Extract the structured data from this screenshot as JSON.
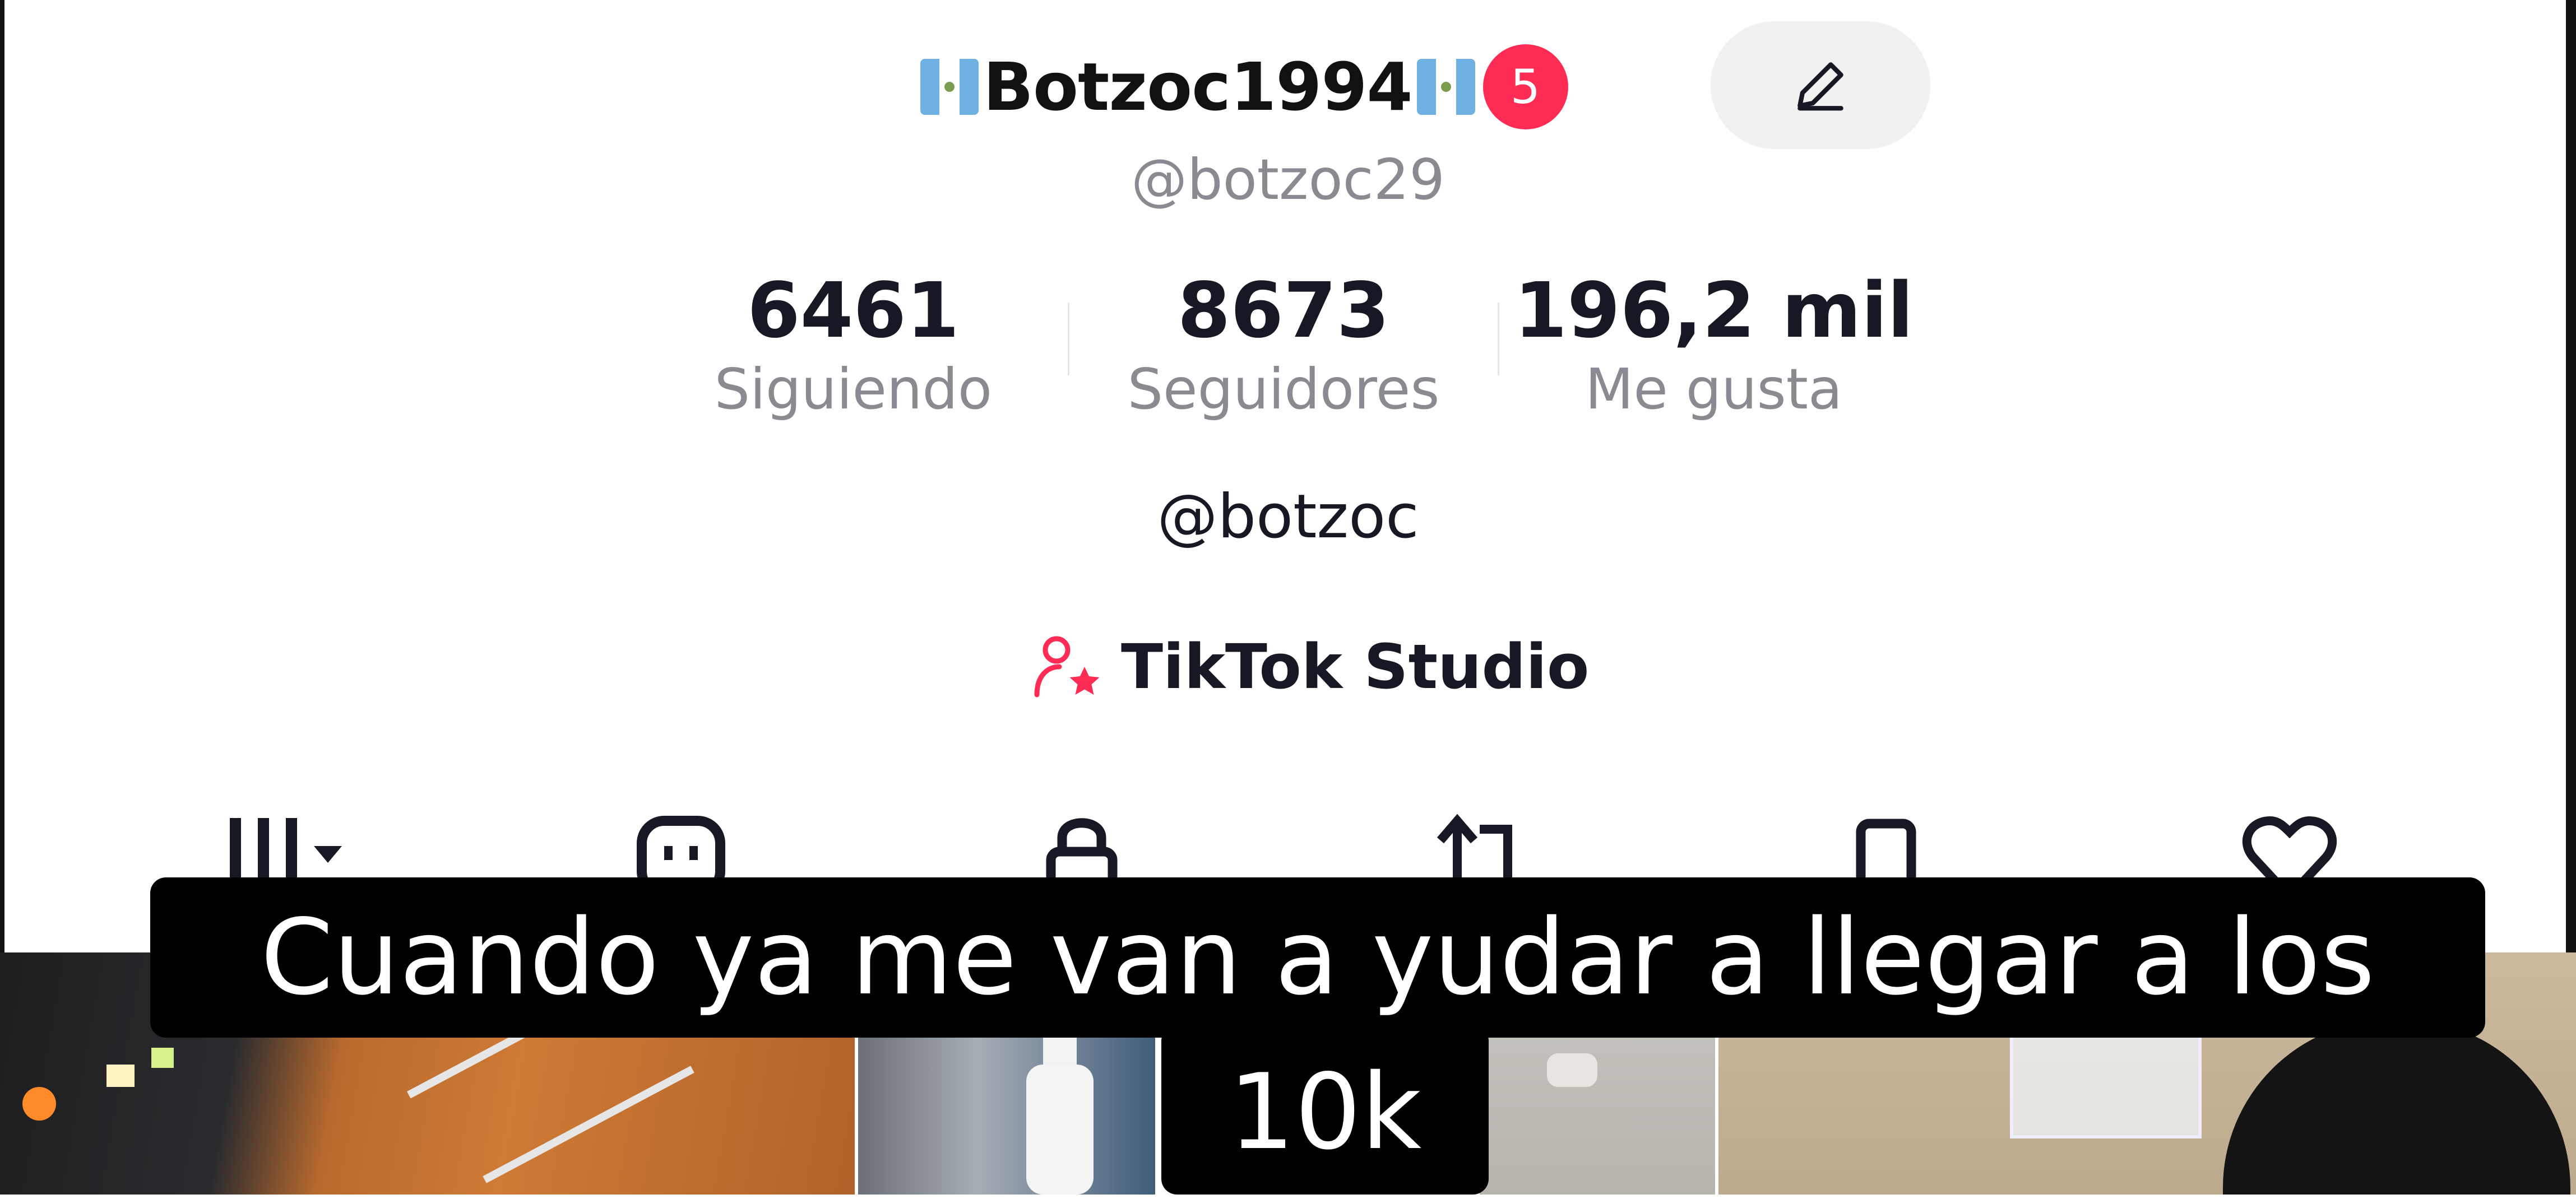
{
  "profile": {
    "display_name": "Botzoc1994",
    "notification_count": "5",
    "username": "@botzoc29",
    "bio": "@botzoc"
  },
  "stats": [
    {
      "value": "6461",
      "label": "Siguiendo"
    },
    {
      "value": "8673",
      "label": "Seguidores"
    },
    {
      "value": "196,2 mil",
      "label": "Me gusta"
    }
  ],
  "studio": {
    "label": "TikTok Studio"
  },
  "icons": {
    "flag": "guatemala-flag-icon",
    "edit": "pencil-icon",
    "studio": "person-star-icon",
    "tabs": [
      "grid-icon",
      "collab-icon",
      "lock-icon",
      "repost-icon",
      "bookmark-icon",
      "heart-icon"
    ]
  },
  "caption": {
    "line1": "Cuando ya me van a yudar a llegar a los",
    "line2": "10k"
  },
  "colors": {
    "accent": "#fe2c55",
    "muted_text": "#8a8b91",
    "primary_text": "#161823"
  }
}
